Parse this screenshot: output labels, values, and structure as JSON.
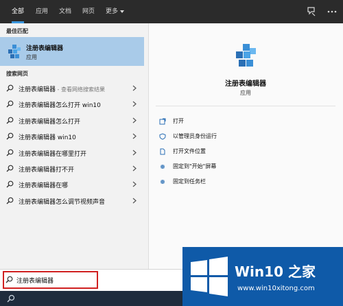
{
  "topbar": {
    "tabs": [
      {
        "label": "全部"
      },
      {
        "label": "应用"
      },
      {
        "label": "文档"
      },
      {
        "label": "网页"
      },
      {
        "label": "更多"
      }
    ],
    "active_tab": "全部",
    "icons": [
      "feedback-icon",
      "more-options-icon"
    ]
  },
  "left": {
    "best_match_header": "最佳匹配",
    "best_match": {
      "title": "注册表编辑器",
      "subtitle": "应用",
      "icon": "registry-editor-icon"
    },
    "web_header": "搜索网页",
    "suggestions": [
      {
        "text": "注册表编辑器",
        "hint": " - 查看网络搜索结果"
      },
      {
        "text": "注册表编辑器怎么打开 win10",
        "hint": ""
      },
      {
        "text": "注册表编辑器怎么打开",
        "hint": ""
      },
      {
        "text": "注册表编辑器 win10",
        "hint": ""
      },
      {
        "text": "注册表编辑器在哪里打开",
        "hint": ""
      },
      {
        "text": "注册表编辑器打不开",
        "hint": ""
      },
      {
        "text": "注册表编辑器在哪",
        "hint": ""
      },
      {
        "text": "注册表编辑器怎么调节视频声音",
        "hint": ""
      }
    ]
  },
  "right": {
    "app_name": "注册表编辑器",
    "app_type": "应用",
    "actions": [
      {
        "label": "打开",
        "icon": "open-icon"
      },
      {
        "label": "以管理员身份运行",
        "icon": "shield-icon"
      },
      {
        "label": "打开文件位置",
        "icon": "file-location-icon"
      },
      {
        "label": "固定到\"开始\"屏幕",
        "icon": "pin-icon"
      },
      {
        "label": "固定到任务栏",
        "icon": "pin-taskbar-icon"
      }
    ]
  },
  "search": {
    "value": "注册表编辑器"
  },
  "watermark": {
    "title": "Win10 之家",
    "url": "www.win10xitong.com"
  },
  "colors": {
    "accent": "#3a96dd",
    "selected": "#a9cbe9",
    "topbar": "#2b2b2b",
    "taskbar": "#1f2c3d",
    "highlight_border": "#d02020"
  }
}
